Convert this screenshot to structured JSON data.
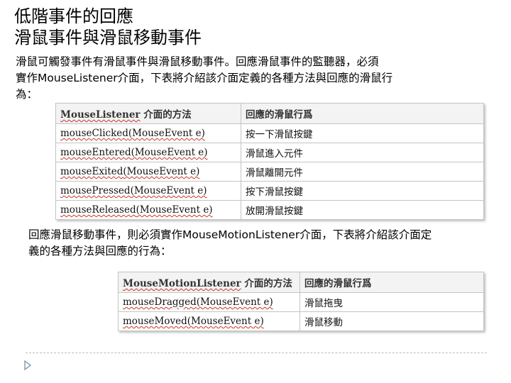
{
  "title": {
    "line1": "低階事件的回應",
    "line2": "滑鼠事件與滑鼠移動事件"
  },
  "para1": {
    "line1": "滑鼠可觸發事件有滑鼠事件與滑鼠移動事件。回應滑鼠事件的監聽器，必須",
    "line2": "實作MouseListener介面，下表將介紹該介面定義的各種方法與回應的滑鼠行",
    "line3": "為："
  },
  "table1": {
    "header": {
      "col1_name": "MouseListener",
      "col1_suffix": " 介面的方法",
      "col2": "回應的滑鼠行爲"
    },
    "rows": [
      {
        "method": "mouseClicked",
        "param": "(MouseEvent e)",
        "action": "按一下滑鼠按鍵"
      },
      {
        "method": "mouseEntered",
        "param": "(MouseEvent e)",
        "action": "滑鼠進入元件"
      },
      {
        "method": "mouseExited",
        "param": "(MouseEvent e)",
        "action": "滑鼠離開元件"
      },
      {
        "method": "mousePressed",
        "param": "(MouseEvent e)",
        "action": "按下滑鼠按鍵"
      },
      {
        "method": "mouseReleased",
        "param": "(MouseEvent e)",
        "action": "放開滑鼠按鍵"
      }
    ]
  },
  "para2": {
    "line1": "回應滑鼠移動事件，則必須實作MouseMotionListener介面，下表將介紹該介面定",
    "line2": "義的各種方法與回應的行為："
  },
  "table2": {
    "header": {
      "col1_name": "MouseMotionListener",
      "col1_suffix": " 介面的方法",
      "col2": "回應的滑鼠行爲"
    },
    "rows": [
      {
        "method": "mouseDragged",
        "param": "(MouseEvent e)",
        "action": "滑鼠拖曳"
      },
      {
        "method": "mouseMoved",
        "param": "(MouseEvent e)",
        "action": "滑鼠移動"
      }
    ]
  },
  "colors": {
    "bullet": "#8a9fb5",
    "squiggle": "#c0392b",
    "header_bg": "#f3f3f3",
    "border": "#c4c4c4"
  },
  "icons": {
    "bullet": "triangle-bullet-icon"
  }
}
